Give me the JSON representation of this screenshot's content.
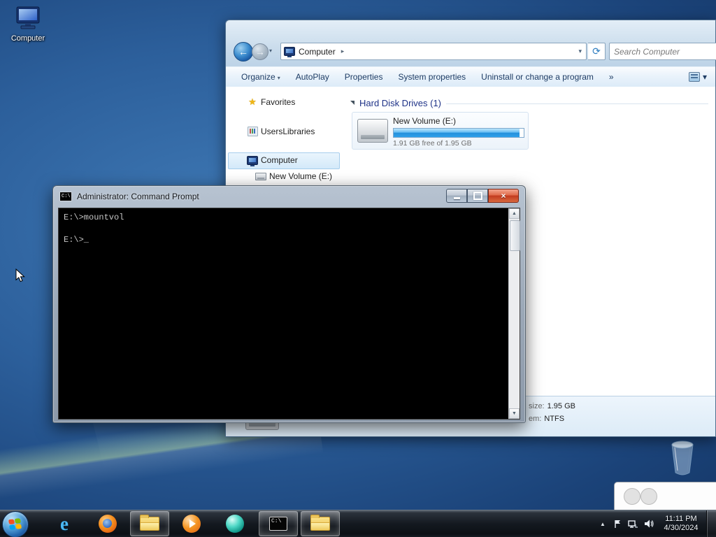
{
  "icons": {
    "back_arrow": "←",
    "forward_arrow": "→",
    "history_dropdown": "▾",
    "breadcrumb_arrow": "▸",
    "address_dropdown": "▾",
    "refresh": "⟳",
    "organize_chevron": "▾",
    "toolbar_overflow": "»",
    "views_chevron": "▾",
    "favorites_star": "★",
    "scroll_up": "▲",
    "scroll_down": "▼",
    "close_x": "×",
    "tray_hidden_arrow": "▲"
  },
  "desktop": {
    "computer_icon_label": "Computer"
  },
  "explorer": {
    "address": {
      "location": "Computer"
    },
    "search": {
      "placeholder": "Search Computer"
    },
    "toolbar": {
      "items": [
        "Organize",
        "AutoPlay",
        "Properties",
        "System properties",
        "Uninstall or change a program"
      ]
    },
    "sidebar": {
      "favorites": "Favorites",
      "libraries": "UsersLibraries",
      "computer": "Computer",
      "volume": "New Volume (E:)"
    },
    "main": {
      "group_header": "Hard Disk Drives (1)",
      "drive": {
        "name": "New Volume (E:)",
        "free_text": "1.91 GB free of 1.95 GB",
        "fill_percent": 97
      }
    },
    "details": {
      "size_label": "size:",
      "size_value": "1.95 GB",
      "fs_label": "em:",
      "fs_value": "NTFS"
    }
  },
  "cmd": {
    "title": "Administrator: Command Prompt",
    "icon_text": "C:\\",
    "lines": [
      "E:\\>mountvol",
      "",
      "E:\\>_"
    ]
  },
  "taskbar": {
    "clock": {
      "time": "11:11 PM",
      "date": "4/30/2024"
    }
  },
  "colors": {
    "group_header_blue": "#1e3287",
    "toolbar_text": "#1e3c64",
    "capacity_fill_blue": "#2490db",
    "taskbar_dark": "#141920"
  }
}
